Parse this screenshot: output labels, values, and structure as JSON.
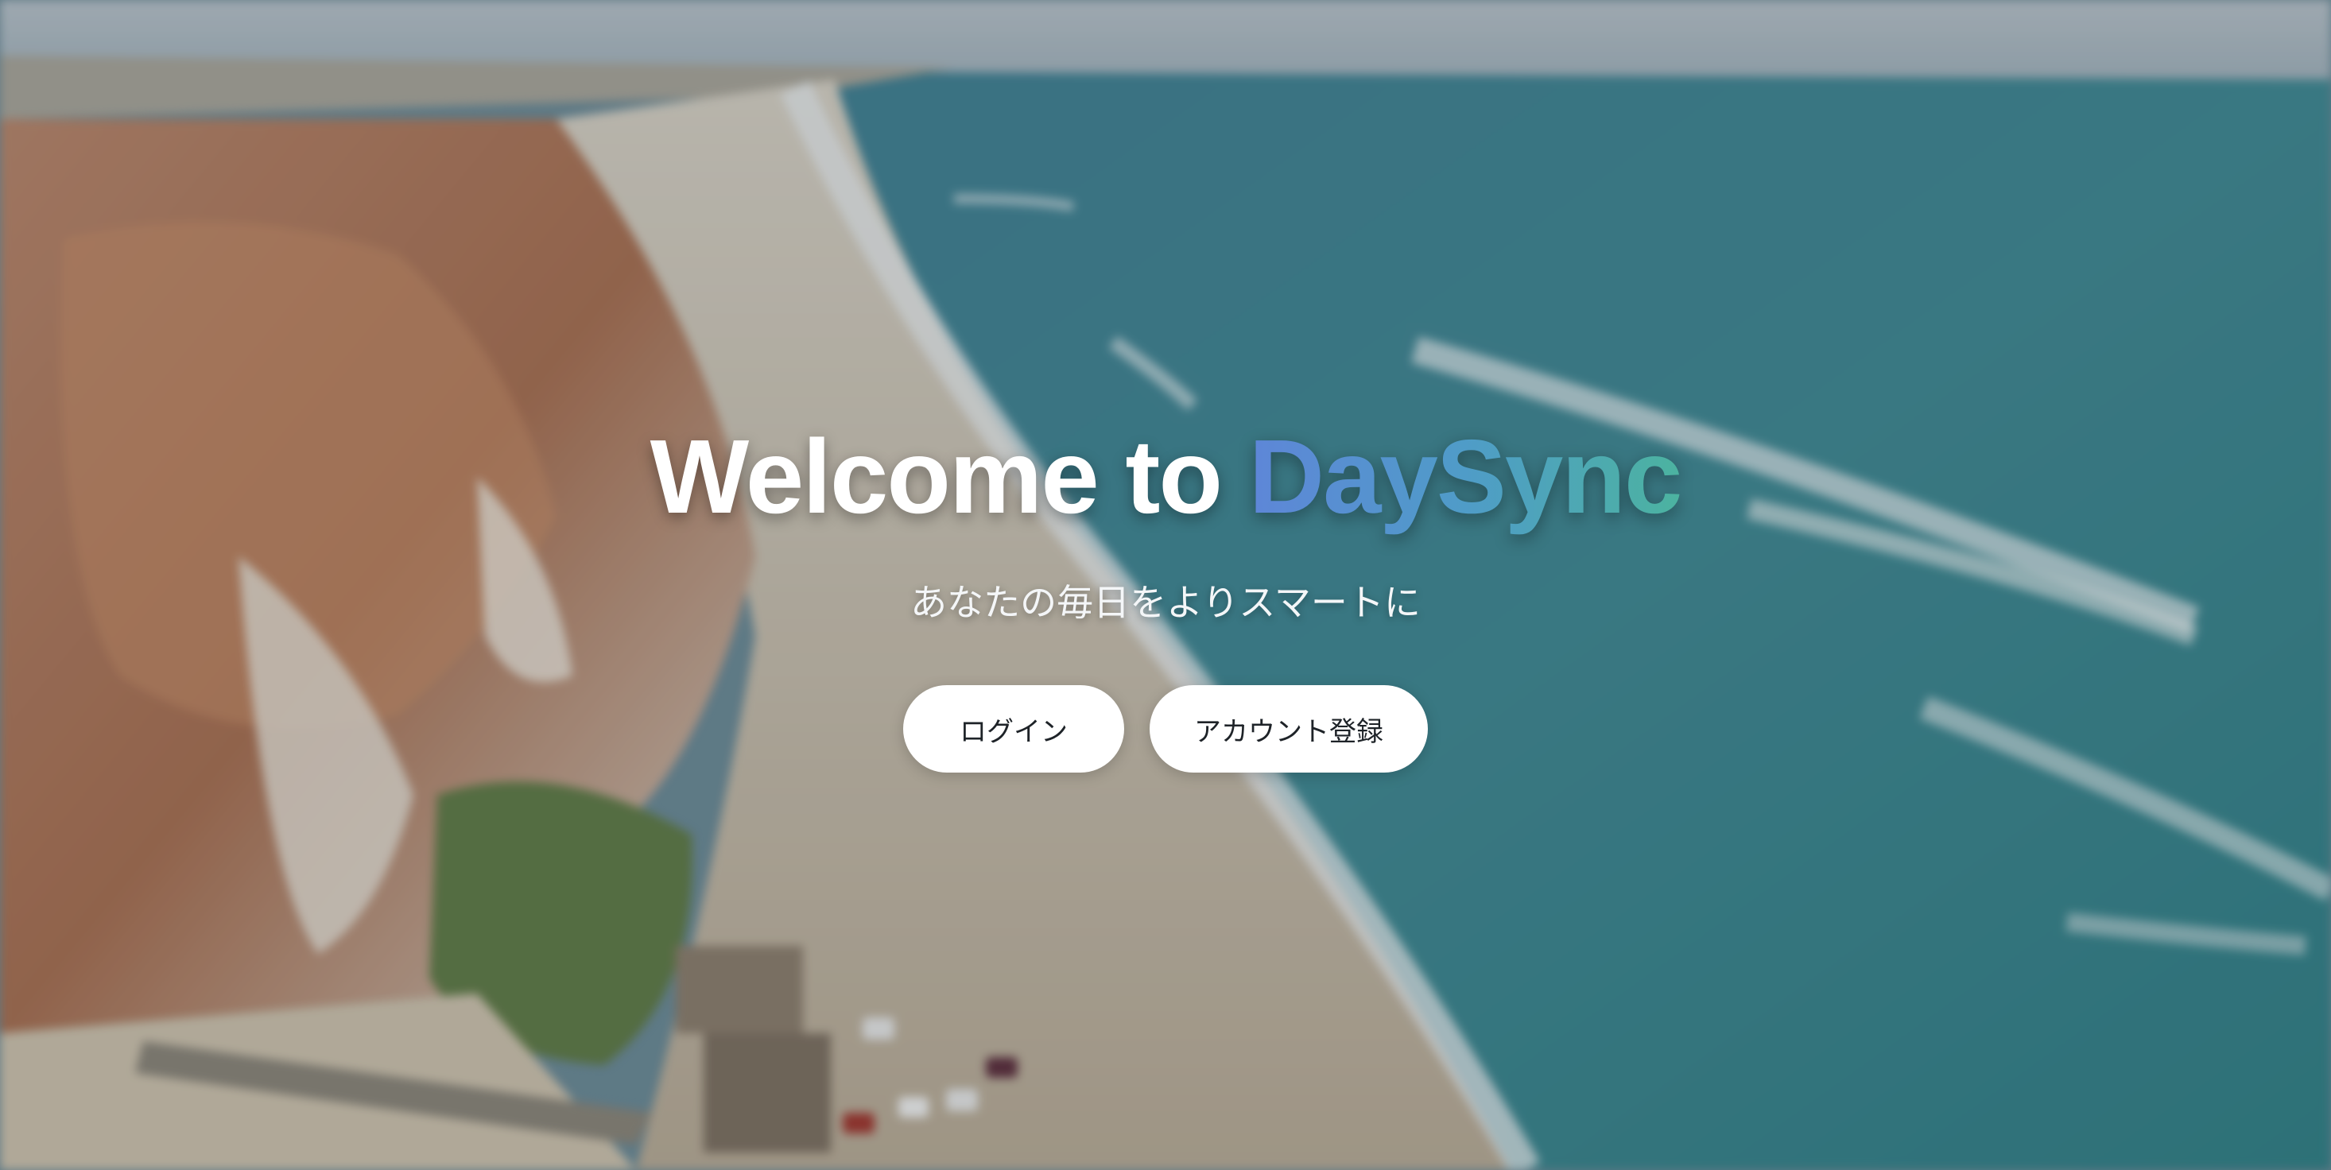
{
  "hero": {
    "title_prefix": "Welcome to ",
    "title_brand": "DaySync",
    "subtitle": "あなたの毎日をよりスマートに"
  },
  "actions": {
    "login_label": "ログイン",
    "register_label": "アカウント登録"
  },
  "colors": {
    "brand_gradient_start": "#5e86d8",
    "brand_gradient_mid": "#4f9cc8",
    "brand_gradient_end": "#4cb3a0",
    "button_background": "#ffffff",
    "button_text": "#1e2328"
  }
}
